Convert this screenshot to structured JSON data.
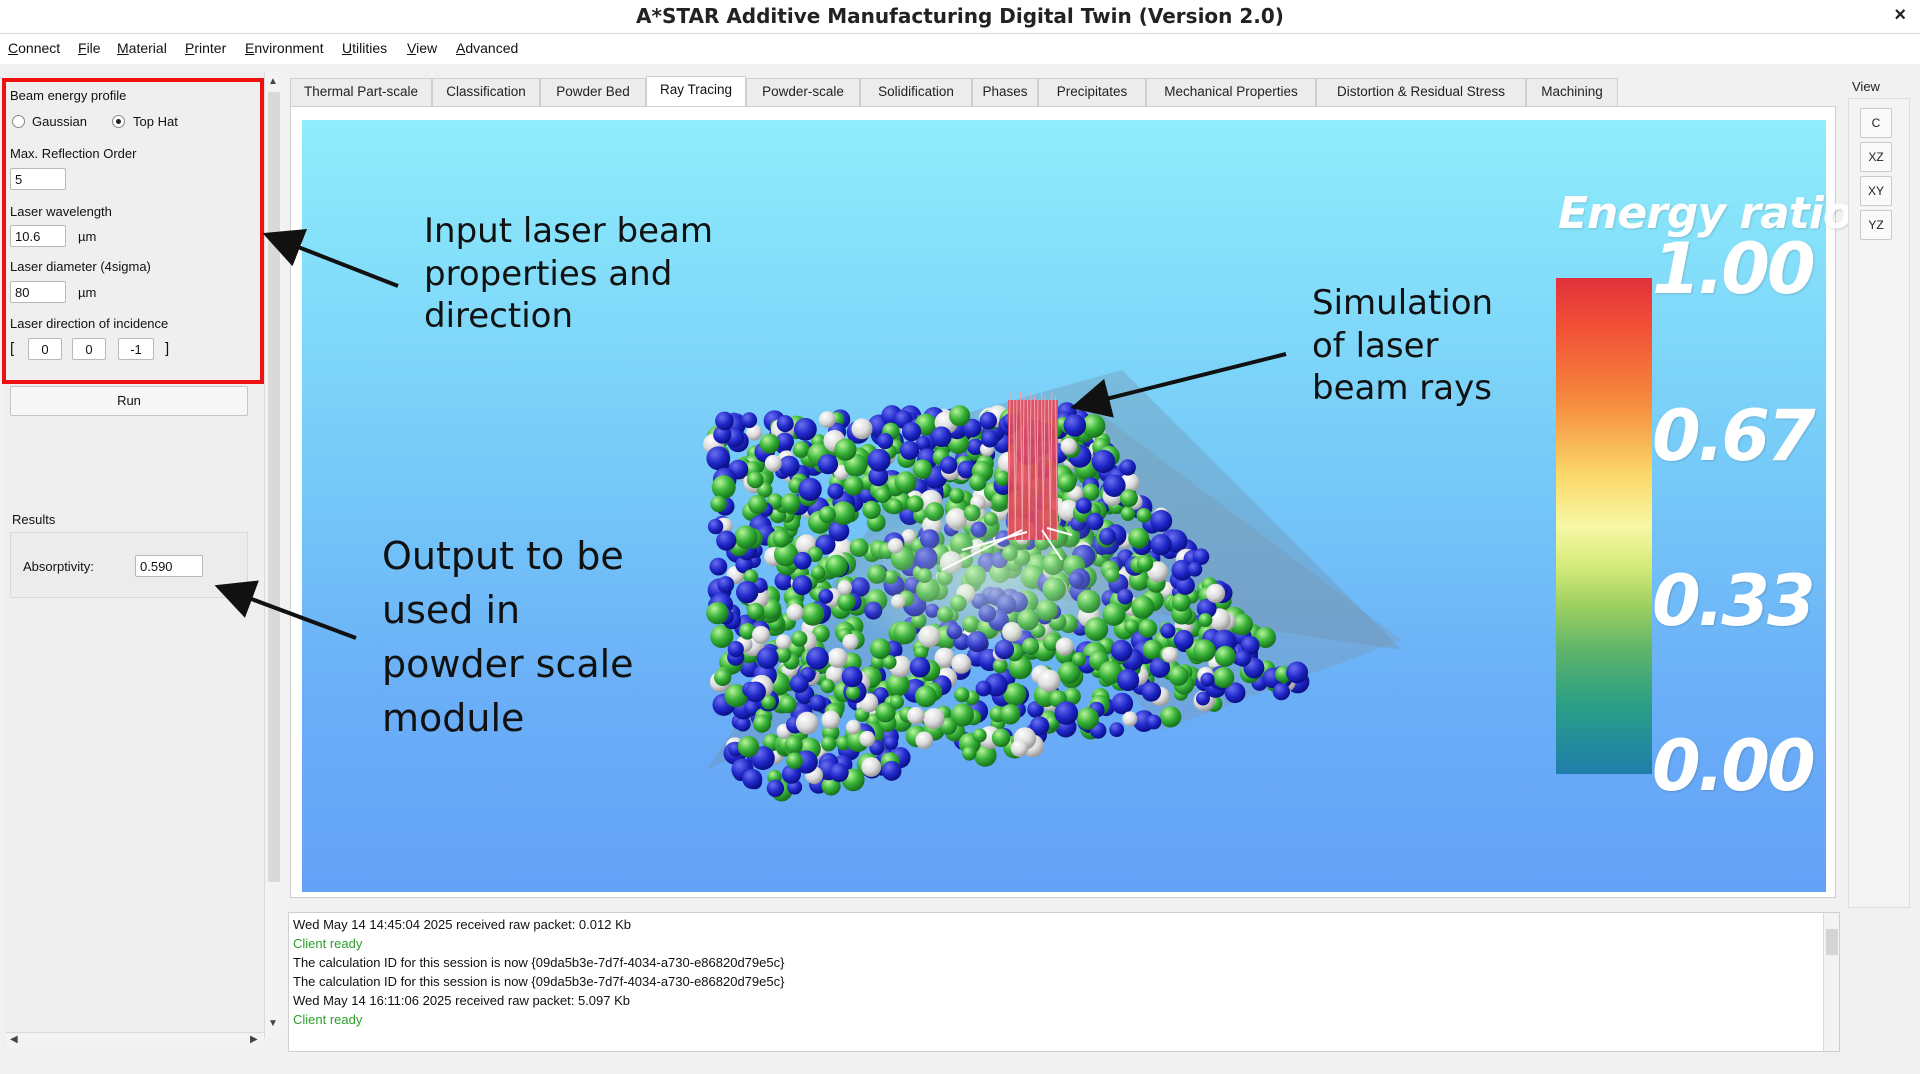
{
  "window": {
    "title": "A*STAR Additive Manufacturing Digital Twin (Version 2.0)",
    "close_glyph": "×"
  },
  "menu": [
    "Connect",
    "File",
    "Material",
    "Printer",
    "Environment",
    "Utilities",
    "View",
    "Advanced"
  ],
  "left_panel": {
    "beam_profile_label": "Beam energy profile",
    "gaussian_label": "Gaussian",
    "tophat_label": "Top Hat",
    "selected_profile": "Top Hat",
    "max_reflection_label": "Max. Reflection Order",
    "max_reflection_value": "5",
    "wavelength_label": "Laser wavelength",
    "wavelength_value": "10.6",
    "wavelength_unit": "µm",
    "diameter_label": "Laser diameter (4sigma)",
    "diameter_value": "80",
    "diameter_unit": "µm",
    "direction_label": "Laser direction of incidence",
    "bracket_open": "[",
    "bracket_close": "]",
    "direction_x": "0",
    "direction_y": "0",
    "direction_z": "-1",
    "run_label": "Run",
    "results_label": "Results",
    "absorptivity_label": "Absorptivity:",
    "absorptivity_value": "0.590"
  },
  "tabs": [
    "Thermal Part-scale",
    "Classification",
    "Powder Bed",
    "Ray Tracing",
    "Powder-scale",
    "Solidification",
    "Phases",
    "Precipitates",
    "Mechanical Properties",
    "Distortion & Residual Stress",
    "Machining"
  ],
  "active_tab": "Ray Tracing",
  "view_panel": {
    "label": "View",
    "buttons": [
      "C",
      "XZ",
      "XY",
      "YZ"
    ]
  },
  "colorbar": {
    "title": "Energy ratio",
    "ticks": [
      "1.00",
      "0.67",
      "0.33",
      "0.00"
    ],
    "range": [
      0,
      1
    ]
  },
  "annotations": {
    "input": [
      "Input laser beam",
      "properties and",
      "direction"
    ],
    "output": [
      "Output to be",
      "used in",
      "powder scale",
      "module"
    ],
    "simulation": [
      "Simulation",
      "of laser",
      "beam rays"
    ]
  },
  "log": [
    {
      "text": "Wed May 14 14:45:04 2025 received raw packet: 0.012 Kb",
      "color": "#111111"
    },
    {
      "text": "Client ready",
      "color": "#2c9e2c"
    },
    {
      "text": "The calculation ID for this session is now {09da5b3e-7d7f-4034-a730-e86820d79e5c}",
      "color": "#111111"
    },
    {
      "text": "The calculation ID for this session is now {09da5b3e-7d7f-4034-a730-e86820d79e5c}",
      "color": "#111111"
    },
    {
      "text": "Wed May 14 16:11:06 2025 received raw packet: 5.097 Kb",
      "color": "#111111"
    },
    {
      "text": "Client ready",
      "color": "#2c9e2c"
    }
  ],
  "colors": {
    "highlight_box": "#ee1111",
    "accent_green": "#2c9e2c"
  }
}
